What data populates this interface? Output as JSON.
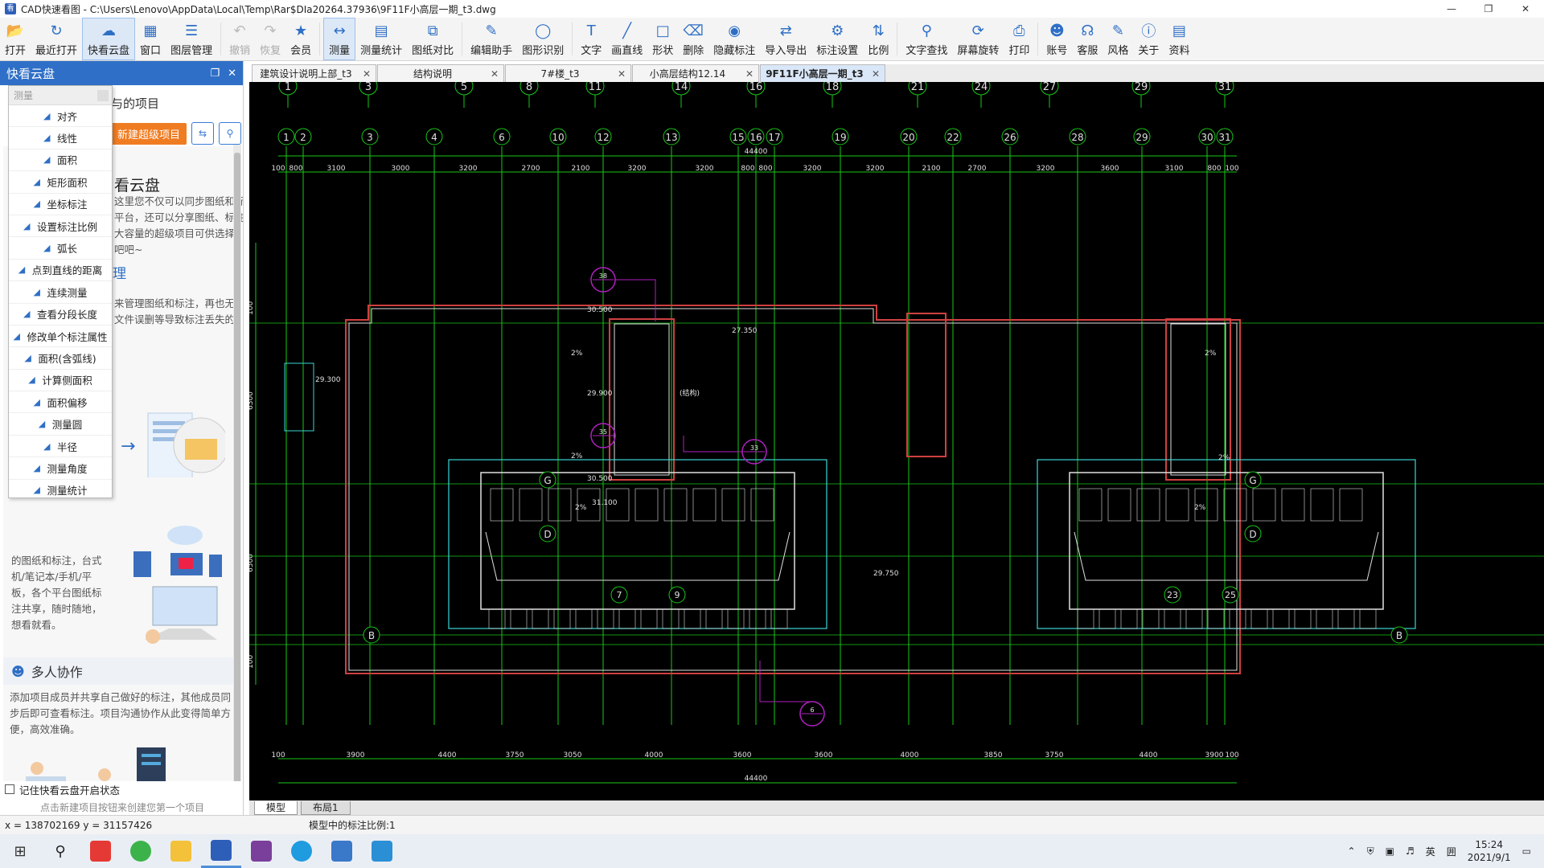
{
  "window": {
    "title": "CAD快速看图 - C:\\Users\\Lenovo\\AppData\\Local\\Temp\\Rar$DIa20264.37936\\9F11F小高层一期_t3.dwg"
  },
  "toolbar": [
    {
      "label": "打开",
      "icon": "folder-open-icon"
    },
    {
      "label": "最近打开",
      "icon": "history-icon"
    },
    {
      "label": "快看云盘",
      "icon": "cloud-icon",
      "active": true
    },
    {
      "label": "窗口",
      "icon": "window-icon"
    },
    {
      "label": "图层管理",
      "icon": "layers-icon"
    },
    {
      "label": "撤销",
      "icon": "undo-icon",
      "disabled": true
    },
    {
      "label": "恢复",
      "icon": "redo-icon",
      "disabled": true
    },
    {
      "label": "会员",
      "icon": "vip-icon"
    },
    {
      "label": "测量",
      "icon": "measure-icon",
      "active": true
    },
    {
      "label": "测量统计",
      "icon": "measure-stats-icon"
    },
    {
      "label": "图纸对比",
      "icon": "compare-icon"
    },
    {
      "label": "编辑助手",
      "icon": "edit-assistant-icon"
    },
    {
      "label": "图形识别",
      "icon": "shape-recognition-icon"
    },
    {
      "label": "文字",
      "icon": "text-icon"
    },
    {
      "label": "画直线",
      "icon": "line-icon"
    },
    {
      "label": "形状",
      "icon": "shape-icon"
    },
    {
      "label": "删除",
      "icon": "eraser-icon"
    },
    {
      "label": "隐藏标注",
      "icon": "hide-annotation-icon"
    },
    {
      "label": "导入导出",
      "icon": "import-export-icon"
    },
    {
      "label": "标注设置",
      "icon": "annotation-settings-icon"
    },
    {
      "label": "比例",
      "icon": "scale-icon"
    },
    {
      "label": "文字查找",
      "icon": "text-search-icon"
    },
    {
      "label": "屏幕旋转",
      "icon": "rotate-screen-icon"
    },
    {
      "label": "打印",
      "icon": "print-icon"
    },
    {
      "label": "账号",
      "icon": "account-icon"
    },
    {
      "label": "客服",
      "icon": "headset-icon"
    },
    {
      "label": "风格",
      "icon": "style-icon"
    },
    {
      "label": "关于",
      "icon": "info-icon"
    },
    {
      "label": "资料",
      "icon": "docs-icon"
    }
  ],
  "side": {
    "header": "快看云盘",
    "project_title": "与的项目",
    "new_project": "新建超级项目",
    "section1": "看云盘",
    "section1_text": "这里您不仅可以同步图纸和标\n平台，还可以分享图纸、标注\n大容量的超级项目可供选择！\n吧吧~",
    "section2_title": "理",
    "section2_text": "来管理图纸和标注，再也无\n文件误删等导致标注丢失的",
    "section3_text": "的图纸和标注，台式\n机/笔记本/手机/平\n板，各个平台图纸标\n注共享，随时随地，\n想看就看。",
    "collab_title": "多人协作",
    "collab_text": "添加项目成员并共享自己做好的标注，其他成员同\n步后即可查看标注。项目沟通协作从此变得简单方\n便，高效准确。",
    "remember": "记住快看云盘开启状态",
    "hint": "点击新建项目按钮来创建您第一个项目"
  },
  "popup": {
    "title": "测量",
    "items": [
      "对齐",
      "线性",
      "面积",
      "矩形面积",
      "坐标标注",
      "设置标注比例",
      "弧长",
      "点到直线的距离",
      "连续测量",
      "查看分段长度",
      "修改单个标注属性",
      "面积(含弧线)",
      "计算侧面积",
      "面积偏移",
      "测量圆",
      "半径",
      "测量角度",
      "测量统计"
    ]
  },
  "tabs": [
    {
      "label": "建筑设计说明上部_t3"
    },
    {
      "label": "结构说明"
    },
    {
      "label": "7#楼_t3"
    },
    {
      "label": "小高层结构12.14"
    },
    {
      "label": "9F11F小高层一期_t3",
      "active": true
    }
  ],
  "drawing": {
    "top_axes": [
      "1",
      "3",
      "5",
      "8",
      "11",
      "14",
      "16",
      "18",
      "21",
      "24",
      "27",
      "29",
      "31"
    ],
    "second_axes": [
      "1",
      "2",
      "3",
      "4",
      "6",
      "10",
      "12",
      "13",
      "15",
      "16",
      "17",
      "19",
      "20",
      "22",
      "26",
      "28",
      "29",
      "30",
      "31"
    ],
    "dims_top": [
      "100",
      "800",
      "3100",
      "3000",
      "3200",
      "2700",
      "2100",
      "3200",
      "3200",
      "800",
      "800",
      "3200",
      "3200",
      "2100",
      "2700",
      "3200",
      "3600",
      "3100",
      "800",
      "100"
    ],
    "dims_bottom": [
      "100",
      "3900",
      "4400",
      "3750",
      "3050",
      "4000",
      "3600",
      "3600",
      "4000",
      "3850",
      "3750",
      "4400",
      "3900",
      "100"
    ],
    "overall": "44400",
    "levels": [
      "30.500",
      "27.350",
      "29.900",
      "(结构)",
      "29.300",
      "30.500",
      "31.100",
      "29.750"
    ],
    "slopes": [
      "2%",
      "2%",
      "2%",
      "2%",
      "2%",
      "2%"
    ],
    "row_labels": [
      "G",
      "D",
      "B",
      "G",
      "D",
      "B"
    ],
    "lower_axes": [
      "7",
      "9",
      "23",
      "25"
    ],
    "callouts": [
      "38",
      "35",
      "33",
      "6"
    ],
    "side_dims": [
      "100",
      "6300",
      "6500",
      "100"
    ]
  },
  "bottom_tabs": [
    {
      "label": "模型",
      "active": true
    },
    {
      "label": "布局1"
    }
  ],
  "status": {
    "coords": "x = 138702169  y = 31157426",
    "scale": "模型中的标注比例:1"
  },
  "taskbar": {
    "tray_lang": "英",
    "tray_grid": "囲",
    "time": "15:24",
    "date": "2021/9/1"
  }
}
